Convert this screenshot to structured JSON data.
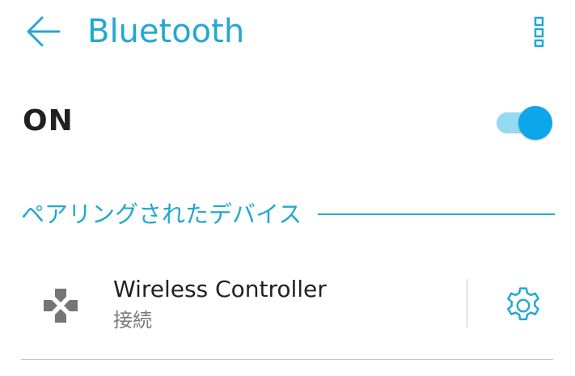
{
  "header": {
    "title": "Bluetooth",
    "back_icon": "arrow-left-icon",
    "more_icon": "more-vertical-icon"
  },
  "bluetooth_toggle": {
    "label": "ON",
    "state": "on"
  },
  "paired_section": {
    "title": "ペアリングされたデバイス"
  },
  "devices": [
    {
      "name": "Wireless Controller",
      "status": "接続",
      "icon": "gamepad-icon",
      "settings_icon": "gear-icon"
    }
  ],
  "colors": {
    "accent": "#23a8cf",
    "switch_track": "#94daf2",
    "switch_thumb": "#0da6ea",
    "device_icon": "#757575"
  }
}
